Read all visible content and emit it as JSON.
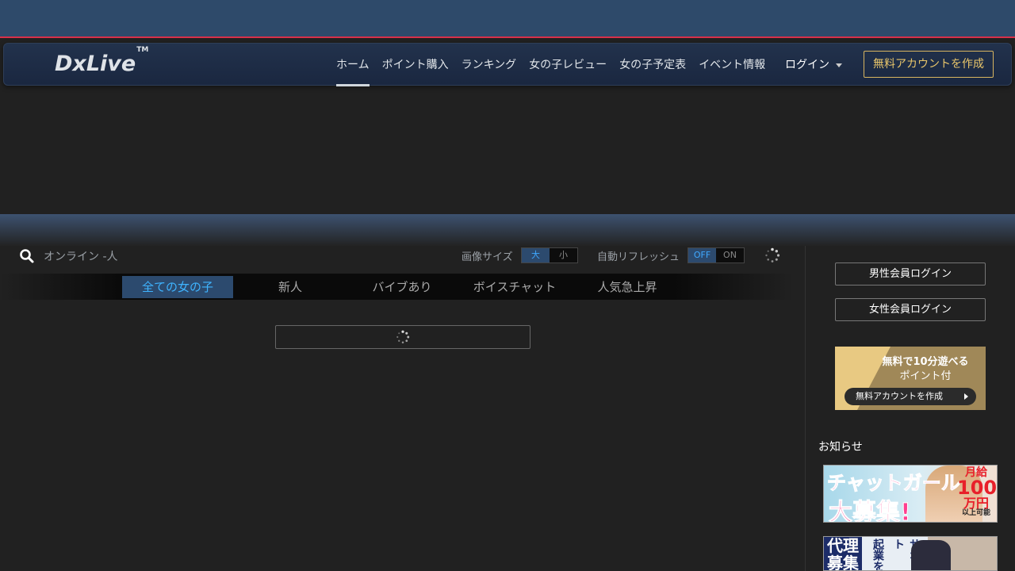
{
  "brand": {
    "logo_text": "DxLive",
    "logo_mark": "TM"
  },
  "nav": {
    "items": [
      {
        "label": "ホーム",
        "active": true
      },
      {
        "label": "ポイント購入"
      },
      {
        "label": "ランキング"
      },
      {
        "label": "女の子レビュー"
      },
      {
        "label": "女の子予定表"
      },
      {
        "label": "イベント情報"
      }
    ],
    "login_label": "ログイン",
    "create_account_label": "無料アカウントを作成"
  },
  "toolbar": {
    "online_text": "オンライン -人",
    "image_size_label": "画像サイズ",
    "image_size_options": [
      "大",
      "小"
    ],
    "image_size_selected": "大",
    "auto_refresh_label": "自動リフレッシュ",
    "auto_refresh_options": [
      "OFF",
      "ON"
    ],
    "auto_refresh_selected": "OFF"
  },
  "categories": {
    "items": [
      "全ての女の子",
      "新人",
      "バイブあり",
      "ボイスチャット",
      "人気急上昇"
    ],
    "active": "全ての女の子"
  },
  "sidebar": {
    "male_login": "男性会員ログイン",
    "female_login": "女性会員ログイン",
    "promo": {
      "line1": "無料で10分遊べる",
      "line2": "ポイント付",
      "button": "無料アカウントを作成"
    },
    "news_title": "お知らせ",
    "ad1": {
      "title1": "チャットガール",
      "title2": "大募集!",
      "badge_a": "月給",
      "badge_b": "100",
      "badge_c": "万円",
      "badge_d": "以上可能"
    },
    "ad2": {
      "block": "代理募集",
      "text1": "起業を",
      "text2": "サポート"
    }
  },
  "colors": {
    "accent": "#3fb4ff",
    "active_bg": "#2c4a6e",
    "top_border": "#d8304a",
    "create_button": "#e8c56a"
  }
}
